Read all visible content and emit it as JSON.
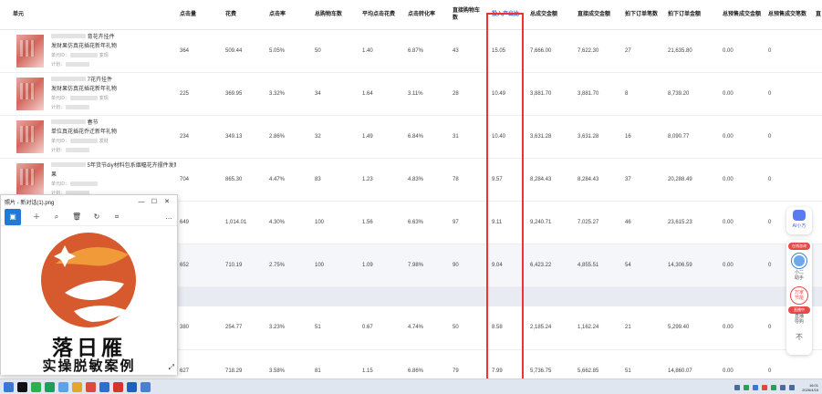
{
  "table": {
    "headers": [
      "单元",
      "点击量",
      "花费",
      "点击率",
      "总购物车数",
      "平均点击花费",
      "点击转化率",
      "直接购物车数",
      "投入产出比",
      "总成交金额",
      "直接成交金额",
      "拍下订单笔数",
      "拍下订单金额",
      "总预售成交金额",
      "总预售成交笔数",
      "直"
    ],
    "rows": [
      {
        "title_a": "育花卉挂件",
        "title_b": "发财果仿真花插花新年礼物",
        "sub_a": "单元ID：",
        "sub_b": "变现",
        "sub_c": "计划：",
        "cells": [
          "364",
          "509.44",
          "5.05%",
          "50",
          "1.40",
          "6.87%",
          "43",
          "15.05",
          "7,666.00",
          "7,622.30",
          "27",
          "21,635.80",
          "0.00",
          "0"
        ]
      },
      {
        "title_a": "7花卉挂件",
        "title_b": "发财果仿真花插花新年礼物",
        "sub_a": "单元ID：",
        "sub_b": "变现",
        "sub_c": "计划：",
        "cells": [
          "225",
          "369.95",
          "3.32%",
          "34",
          "1.64",
          "3.11%",
          "28",
          "10.49",
          "3,881.70",
          "3,881.70",
          "8",
          "8,739.20",
          "0.00",
          "0"
        ]
      },
      {
        "title_a": "春节",
        "title_b": "单位真花插花乔迁新年礼物",
        "sub_a": "单元ID：",
        "sub_b": "发财",
        "sub_c": "计划：",
        "cells": [
          "234",
          "349.13",
          "2.86%",
          "32",
          "1.49",
          "6.84%",
          "31",
          "10.40",
          "3,631.28",
          "3,631.28",
          "16",
          "8,090.77",
          "0.00",
          "0"
        ]
      },
      {
        "title_a": "5年货节diy材料包系烟幅花卉摆件发财",
        "title_b": "果",
        "sub_a": "单元ID：",
        "sub_b": "",
        "sub_c": "计划：",
        "cells": [
          "704",
          "865.30",
          "4.47%",
          "83",
          "1.23",
          "4.83%",
          "78",
          "9.57",
          "8,284.43",
          "8,284.43",
          "37",
          "20,288.49",
          "0.00",
          "0"
        ]
      },
      {
        "title_a": "",
        "title_b": "",
        "sub_a": "",
        "sub_b": "",
        "sub_c": "",
        "cells": [
          "649",
          "1,014.01",
          "4.30%",
          "100",
          "1.56",
          "6.63%",
          "97",
          "9.11",
          "9,240.71",
          "7,025.27",
          "46",
          "23,615.23",
          "0.00",
          "0"
        ]
      },
      {
        "title_a": "",
        "title_b": "",
        "sub_a": "",
        "sub_b": "",
        "sub_c": "",
        "cells": [
          "652",
          "710.19",
          "2.75%",
          "100",
          "1.09",
          "7.98%",
          "90",
          "9.04",
          "6,423.22",
          "4,855.51",
          "54",
          "14,306.59",
          "0.00",
          "0"
        ]
      },
      {
        "title_a": "",
        "title_b": "",
        "sub_a": "",
        "sub_b": "",
        "sub_c": "",
        "cells": [
          "380",
          "254.77",
          "3.23%",
          "51",
          "0.67",
          "4.74%",
          "50",
          "8.58",
          "2,185.24",
          "1,162.24",
          "21",
          "5,299.40",
          "0.00",
          "0"
        ]
      },
      {
        "title_a": "",
        "title_b": "",
        "sub_a": "",
        "sub_b": "",
        "sub_c": "",
        "cells": [
          "627",
          "718.29",
          "3.58%",
          "81",
          "1.15",
          "6.86%",
          "79",
          "7.99",
          "5,736.75",
          "5,662.85",
          "51",
          "14,860.07",
          "0.00",
          "0"
        ]
      }
    ]
  },
  "viewer": {
    "title": "照片 - 新对话(1).png",
    "brand_main": "落日雁",
    "brand_sub": "实操脱敏案例",
    "icons": [
      "image-icon",
      "add-icon",
      "zoom-icon",
      "delete-icon",
      "rotate-icon",
      "crop-icon",
      "more-icon"
    ]
  },
  "side": {
    "ai_label": "AI小万",
    "pill": "在线咨询",
    "avatar_label_a": "小二",
    "avatar_label_b": "助手",
    "gift_a": "万家",
    "gift_b": "节能",
    "gift_pill": "直播中",
    "live_a": "直播",
    "live_b": "导购",
    "up": "不"
  },
  "taskbar": {
    "time": "16:01",
    "date": "2026/4/16"
  },
  "colors": {
    "highlight": "#e33333",
    "accent": "#1f7ad8"
  }
}
